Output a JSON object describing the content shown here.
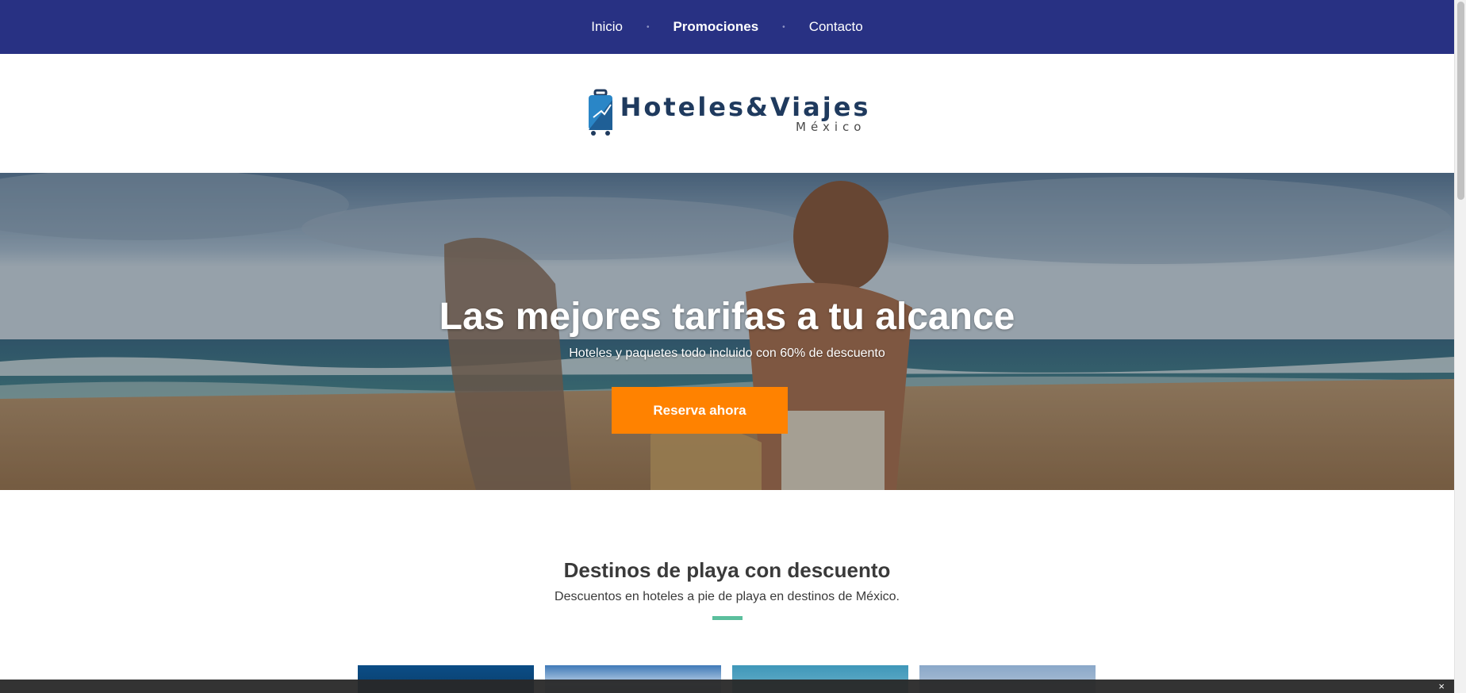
{
  "nav": {
    "items": [
      {
        "label": "Inicio",
        "active": false
      },
      {
        "label": "Promociones",
        "active": true
      },
      {
        "label": "Contacto",
        "active": false
      }
    ],
    "separator": "•"
  },
  "logo": {
    "main": "Hoteles&Viajes",
    "sub": "México"
  },
  "hero": {
    "title": "Las mejores tarifas a tu alcance",
    "subtitle": "Hoteles y paquetes todo incluido  con 60% de descuento",
    "cta_label": "Reserva ahora"
  },
  "section": {
    "title": "Destinos de playa con descuento",
    "subtitle": "Descuentos en hoteles a pie de playa en destinos de México."
  },
  "cookie_bar": {
    "close_label": "×"
  },
  "colors": {
    "nav_bg": "#283183",
    "cta": "#ff8200",
    "divider": "#5bbf9d",
    "heading": "#3a3a3a"
  },
  "icons": [
    "suitcase-logo-icon",
    "close-icon"
  ]
}
